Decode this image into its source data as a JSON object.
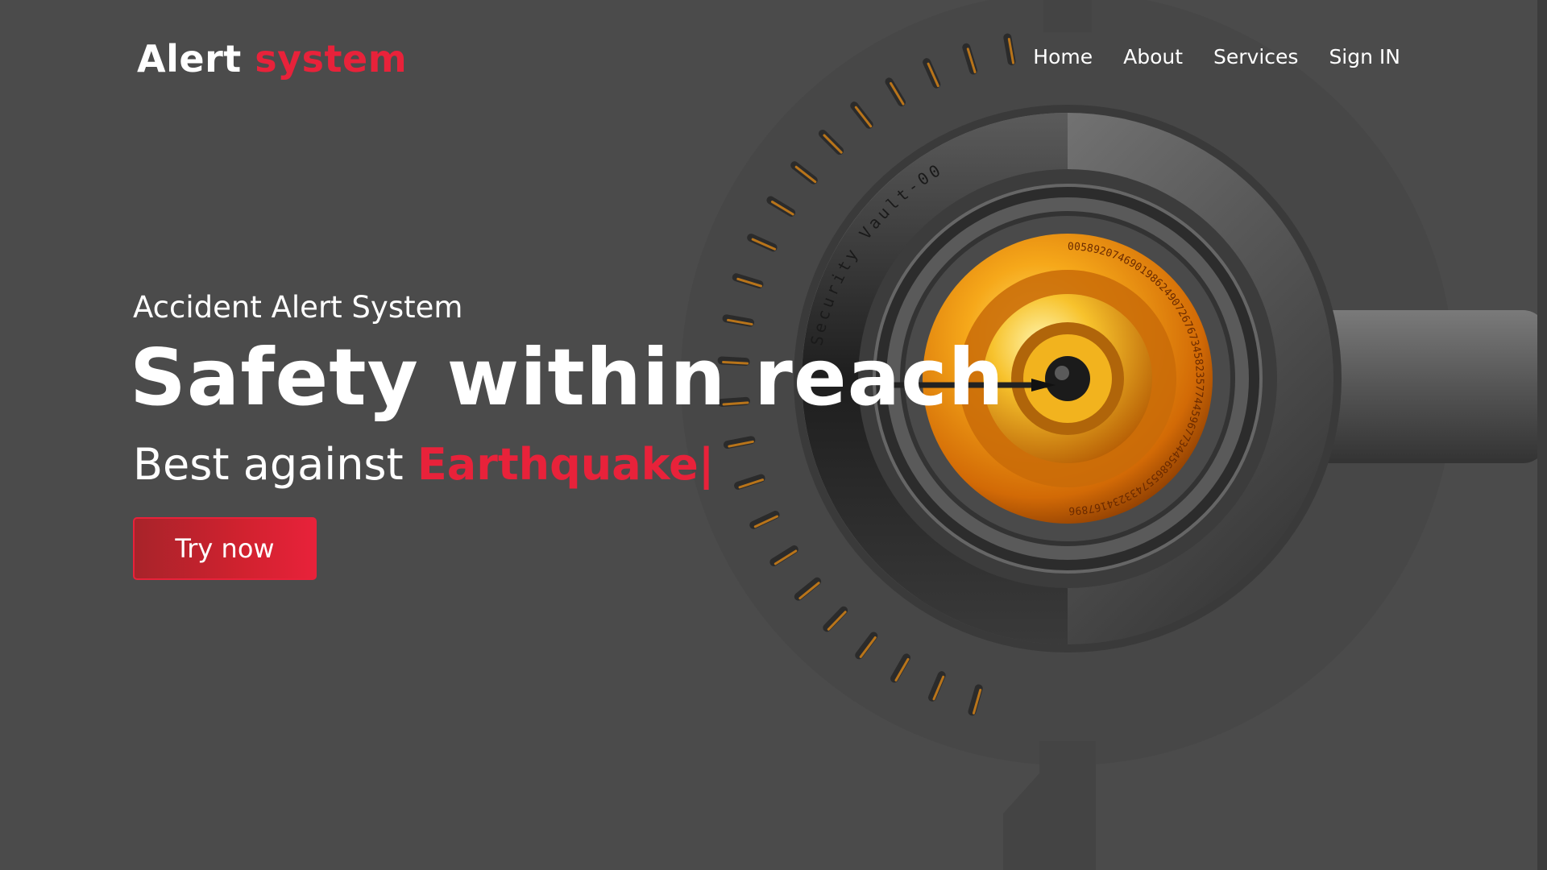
{
  "brand": {
    "name_primary": "Alert",
    "name_accent": "system"
  },
  "nav": {
    "items": [
      "Home",
      "About",
      "Services",
      "Sign IN"
    ]
  },
  "hero": {
    "kicker": "Accident Alert System",
    "title": "Safety within reach",
    "subtitle_prefix": "Best against",
    "subtitle_typed": "Earthquake",
    "cursor": "|",
    "cta_label": "Try now"
  },
  "illustration": {
    "vault_label": "Security Vault-003",
    "dial_digits": "0058920746901986249072676734582357744596773445686557433234167896"
  },
  "colors": {
    "background": "#4b4b4b",
    "accent": "#e8223a",
    "dial_orange": "#f39c12"
  }
}
